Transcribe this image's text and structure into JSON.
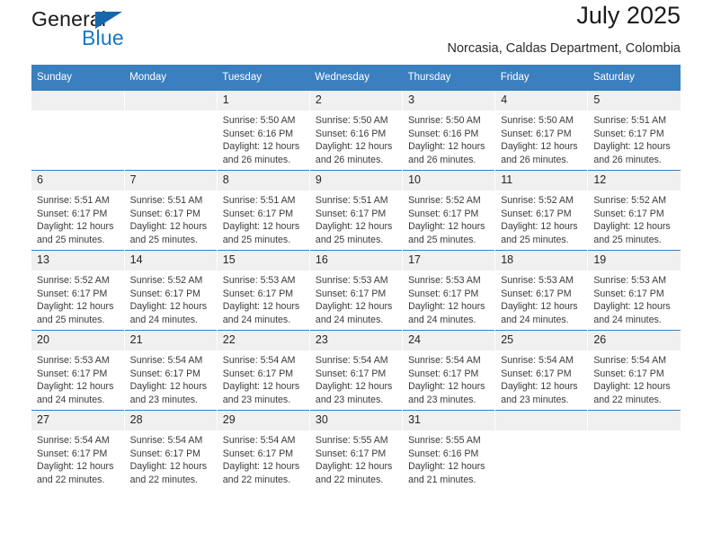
{
  "brand": {
    "name_part1": "General",
    "name_part2": "Blue",
    "accent_color": "#1878c4",
    "triangle_color": "#1566ab",
    "logo_icon": "triangle-flag-icon"
  },
  "header": {
    "title": "July 2025",
    "subtitle": "Norcasia, Caldas Department, Colombia"
  },
  "calendar": {
    "header_bg": "#3b7fc0",
    "daynum_bg": "#f0f0f0",
    "weekday_headers": [
      "Sunday",
      "Monday",
      "Tuesday",
      "Wednesday",
      "Thursday",
      "Friday",
      "Saturday"
    ],
    "labels": {
      "sunrise_prefix": "Sunrise:",
      "sunset_prefix": "Sunset:",
      "daylight_prefix": "Daylight:"
    },
    "weeks": [
      [
        {
          "day": "",
          "sunrise": "",
          "sunset": "",
          "daylight_line1": "",
          "daylight_line2": "",
          "blank": true
        },
        {
          "day": "",
          "sunrise": "",
          "sunset": "",
          "daylight_line1": "",
          "daylight_line2": "",
          "blank": true
        },
        {
          "day": "1",
          "sunrise": "Sunrise: 5:50 AM",
          "sunset": "Sunset: 6:16 PM",
          "daylight_line1": "Daylight: 12 hours",
          "daylight_line2": "and 26 minutes."
        },
        {
          "day": "2",
          "sunrise": "Sunrise: 5:50 AM",
          "sunset": "Sunset: 6:16 PM",
          "daylight_line1": "Daylight: 12 hours",
          "daylight_line2": "and 26 minutes."
        },
        {
          "day": "3",
          "sunrise": "Sunrise: 5:50 AM",
          "sunset": "Sunset: 6:16 PM",
          "daylight_line1": "Daylight: 12 hours",
          "daylight_line2": "and 26 minutes."
        },
        {
          "day": "4",
          "sunrise": "Sunrise: 5:50 AM",
          "sunset": "Sunset: 6:17 PM",
          "daylight_line1": "Daylight: 12 hours",
          "daylight_line2": "and 26 minutes."
        },
        {
          "day": "5",
          "sunrise": "Sunrise: 5:51 AM",
          "sunset": "Sunset: 6:17 PM",
          "daylight_line1": "Daylight: 12 hours",
          "daylight_line2": "and 26 minutes."
        }
      ],
      [
        {
          "day": "6",
          "sunrise": "Sunrise: 5:51 AM",
          "sunset": "Sunset: 6:17 PM",
          "daylight_line1": "Daylight: 12 hours",
          "daylight_line2": "and 25 minutes."
        },
        {
          "day": "7",
          "sunrise": "Sunrise: 5:51 AM",
          "sunset": "Sunset: 6:17 PM",
          "daylight_line1": "Daylight: 12 hours",
          "daylight_line2": "and 25 minutes."
        },
        {
          "day": "8",
          "sunrise": "Sunrise: 5:51 AM",
          "sunset": "Sunset: 6:17 PM",
          "daylight_line1": "Daylight: 12 hours",
          "daylight_line2": "and 25 minutes."
        },
        {
          "day": "9",
          "sunrise": "Sunrise: 5:51 AM",
          "sunset": "Sunset: 6:17 PM",
          "daylight_line1": "Daylight: 12 hours",
          "daylight_line2": "and 25 minutes."
        },
        {
          "day": "10",
          "sunrise": "Sunrise: 5:52 AM",
          "sunset": "Sunset: 6:17 PM",
          "daylight_line1": "Daylight: 12 hours",
          "daylight_line2": "and 25 minutes."
        },
        {
          "day": "11",
          "sunrise": "Sunrise: 5:52 AM",
          "sunset": "Sunset: 6:17 PM",
          "daylight_line1": "Daylight: 12 hours",
          "daylight_line2": "and 25 minutes."
        },
        {
          "day": "12",
          "sunrise": "Sunrise: 5:52 AM",
          "sunset": "Sunset: 6:17 PM",
          "daylight_line1": "Daylight: 12 hours",
          "daylight_line2": "and 25 minutes."
        }
      ],
      [
        {
          "day": "13",
          "sunrise": "Sunrise: 5:52 AM",
          "sunset": "Sunset: 6:17 PM",
          "daylight_line1": "Daylight: 12 hours",
          "daylight_line2": "and 25 minutes."
        },
        {
          "day": "14",
          "sunrise": "Sunrise: 5:52 AM",
          "sunset": "Sunset: 6:17 PM",
          "daylight_line1": "Daylight: 12 hours",
          "daylight_line2": "and 24 minutes."
        },
        {
          "day": "15",
          "sunrise": "Sunrise: 5:53 AM",
          "sunset": "Sunset: 6:17 PM",
          "daylight_line1": "Daylight: 12 hours",
          "daylight_line2": "and 24 minutes."
        },
        {
          "day": "16",
          "sunrise": "Sunrise: 5:53 AM",
          "sunset": "Sunset: 6:17 PM",
          "daylight_line1": "Daylight: 12 hours",
          "daylight_line2": "and 24 minutes."
        },
        {
          "day": "17",
          "sunrise": "Sunrise: 5:53 AM",
          "sunset": "Sunset: 6:17 PM",
          "daylight_line1": "Daylight: 12 hours",
          "daylight_line2": "and 24 minutes."
        },
        {
          "day": "18",
          "sunrise": "Sunrise: 5:53 AM",
          "sunset": "Sunset: 6:17 PM",
          "daylight_line1": "Daylight: 12 hours",
          "daylight_line2": "and 24 minutes."
        },
        {
          "day": "19",
          "sunrise": "Sunrise: 5:53 AM",
          "sunset": "Sunset: 6:17 PM",
          "daylight_line1": "Daylight: 12 hours",
          "daylight_line2": "and 24 minutes."
        }
      ],
      [
        {
          "day": "20",
          "sunrise": "Sunrise: 5:53 AM",
          "sunset": "Sunset: 6:17 PM",
          "daylight_line1": "Daylight: 12 hours",
          "daylight_line2": "and 24 minutes."
        },
        {
          "day": "21",
          "sunrise": "Sunrise: 5:54 AM",
          "sunset": "Sunset: 6:17 PM",
          "daylight_line1": "Daylight: 12 hours",
          "daylight_line2": "and 23 minutes."
        },
        {
          "day": "22",
          "sunrise": "Sunrise: 5:54 AM",
          "sunset": "Sunset: 6:17 PM",
          "daylight_line1": "Daylight: 12 hours",
          "daylight_line2": "and 23 minutes."
        },
        {
          "day": "23",
          "sunrise": "Sunrise: 5:54 AM",
          "sunset": "Sunset: 6:17 PM",
          "daylight_line1": "Daylight: 12 hours",
          "daylight_line2": "and 23 minutes."
        },
        {
          "day": "24",
          "sunrise": "Sunrise: 5:54 AM",
          "sunset": "Sunset: 6:17 PM",
          "daylight_line1": "Daylight: 12 hours",
          "daylight_line2": "and 23 minutes."
        },
        {
          "day": "25",
          "sunrise": "Sunrise: 5:54 AM",
          "sunset": "Sunset: 6:17 PM",
          "daylight_line1": "Daylight: 12 hours",
          "daylight_line2": "and 23 minutes."
        },
        {
          "day": "26",
          "sunrise": "Sunrise: 5:54 AM",
          "sunset": "Sunset: 6:17 PM",
          "daylight_line1": "Daylight: 12 hours",
          "daylight_line2": "and 22 minutes."
        }
      ],
      [
        {
          "day": "27",
          "sunrise": "Sunrise: 5:54 AM",
          "sunset": "Sunset: 6:17 PM",
          "daylight_line1": "Daylight: 12 hours",
          "daylight_line2": "and 22 minutes."
        },
        {
          "day": "28",
          "sunrise": "Sunrise: 5:54 AM",
          "sunset": "Sunset: 6:17 PM",
          "daylight_line1": "Daylight: 12 hours",
          "daylight_line2": "and 22 minutes."
        },
        {
          "day": "29",
          "sunrise": "Sunrise: 5:54 AM",
          "sunset": "Sunset: 6:17 PM",
          "daylight_line1": "Daylight: 12 hours",
          "daylight_line2": "and 22 minutes."
        },
        {
          "day": "30",
          "sunrise": "Sunrise: 5:55 AM",
          "sunset": "Sunset: 6:17 PM",
          "daylight_line1": "Daylight: 12 hours",
          "daylight_line2": "and 22 minutes."
        },
        {
          "day": "31",
          "sunrise": "Sunrise: 5:55 AM",
          "sunset": "Sunset: 6:16 PM",
          "daylight_line1": "Daylight: 12 hours",
          "daylight_line2": "and 21 minutes."
        },
        {
          "day": "",
          "sunrise": "",
          "sunset": "",
          "daylight_line1": "",
          "daylight_line2": "",
          "blank": true
        },
        {
          "day": "",
          "sunrise": "",
          "sunset": "",
          "daylight_line1": "",
          "daylight_line2": "",
          "blank": true
        }
      ]
    ]
  }
}
